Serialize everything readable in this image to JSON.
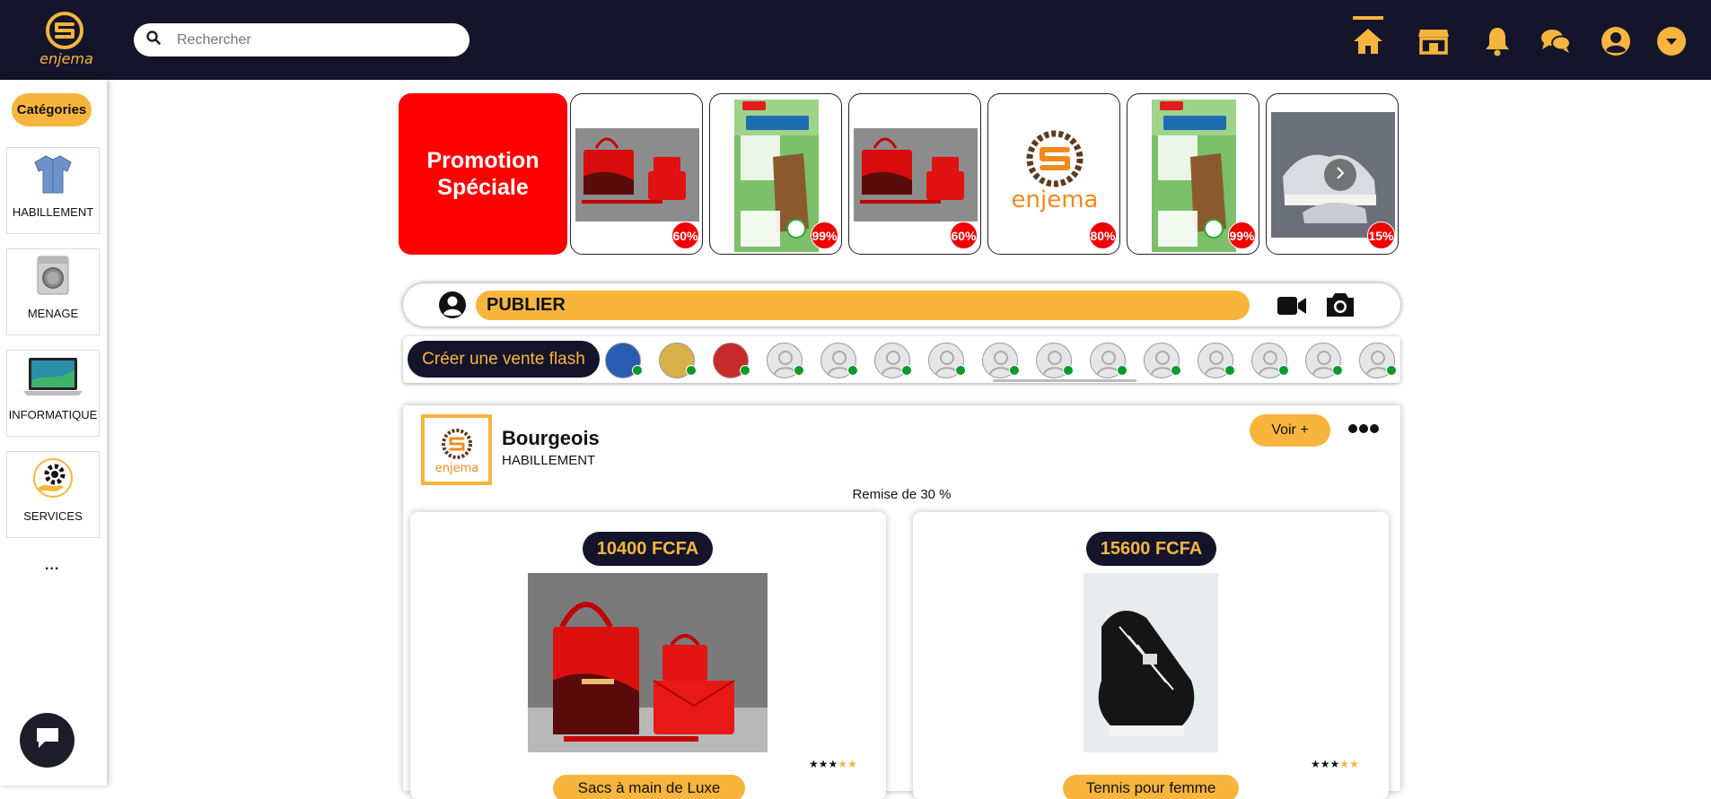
{
  "brand": {
    "name": "enjema",
    "accent": "#f7b53e",
    "dark": "#14142b"
  },
  "search": {
    "placeholder": "Rechercher"
  },
  "nav": {
    "icons": [
      "home-icon",
      "store-icon",
      "bell-icon",
      "chat-icon",
      "user-icon",
      "chevron-down-icon"
    ],
    "active": "home"
  },
  "sidebar": {
    "categories_label": "Catégories",
    "items": [
      {
        "label": "HABILLEMENT",
        "icon": "shirt-icon"
      },
      {
        "label": "MENAGE",
        "icon": "washing-machine-icon"
      },
      {
        "label": "INFORMATIQUE",
        "icon": "laptop-icon"
      },
      {
        "label": "SERVICES",
        "icon": "services-gear-icon"
      }
    ],
    "more": "..."
  },
  "promotions": {
    "title": "Promotion Spéciale",
    "items": [
      {
        "kind": "red-bags",
        "discount": "60%"
      },
      {
        "kind": "djeka-flyer",
        "discount": "99%"
      },
      {
        "kind": "red-bags",
        "discount": "60%"
      },
      {
        "kind": "enjema-logo",
        "discount": "80%"
      },
      {
        "kind": "djeka-flyer",
        "discount": "99%"
      },
      {
        "kind": "sneakers",
        "discount": "15%"
      }
    ]
  },
  "publish": {
    "label": "PUBLIER"
  },
  "flash": {
    "create_label": "Créer une vente flash",
    "story_count": 15
  },
  "post": {
    "shop_name": "Bourgeois",
    "shop_category": "HABILLEMENT",
    "see_more": "Voir +",
    "discount_text": "Remise de 30 %",
    "products": [
      {
        "price": "10400 FCFA",
        "name": "Sacs à main de Luxe",
        "rating": 3,
        "max_rating": 5
      },
      {
        "price": "15600 FCFA",
        "name": "Tennis pour femme",
        "rating": 3,
        "max_rating": 5
      }
    ]
  }
}
